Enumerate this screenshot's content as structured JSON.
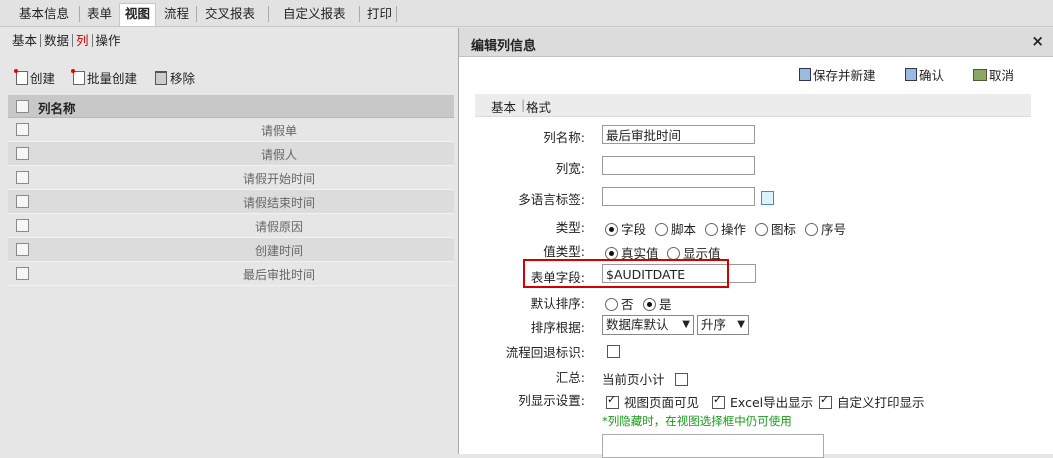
{
  "top_tabs": [
    "基本信息",
    "表单",
    "视图",
    "流程",
    "交叉报表",
    "自定义报表",
    "打印"
  ],
  "left": {
    "subtabs": [
      "基本",
      "数据",
      "列",
      "操作"
    ],
    "toolbar": {
      "create": "创建",
      "batch_create": "批量创建",
      "remove": "移除"
    },
    "grid_header": "列名称",
    "rows": [
      "请假单",
      "请假人",
      "请假开始时间",
      "请假结束时间",
      "请假原因",
      "创建时间",
      "最后审批时间"
    ]
  },
  "dialog": {
    "title": "编辑列信息",
    "close": "×",
    "buttons": {
      "save_new": "保存并新建",
      "ok": "确认",
      "cancel": "取消"
    },
    "form_tabs": [
      "基本",
      "格式"
    ],
    "fields": {
      "col_name": {
        "label": "列名称:",
        "value": "最后审批时间"
      },
      "col_width": {
        "label": "列宽:",
        "value": ""
      },
      "i18n": {
        "label": "多语言标签:",
        "value": ""
      },
      "type": {
        "label": "类型:",
        "options": [
          "字段",
          "脚本",
          "操作",
          "图标",
          "序号"
        ],
        "selected": "字段"
      },
      "value_type": {
        "label": "值类型:",
        "options": [
          "真实值",
          "显示值"
        ],
        "selected": "真实值"
      },
      "form_field": {
        "label": "表单字段:",
        "value": "$AUDITDATE"
      },
      "default_sort": {
        "label": "默认排序:",
        "options": [
          "否",
          "是"
        ],
        "selected": "是"
      },
      "sort_by": {
        "label": "排序根据:",
        "select1": "数据库默认",
        "select2": "升序"
      },
      "flow_back": {
        "label": "流程回退标识:"
      },
      "summary": {
        "label": "汇总:",
        "option": "当前页小计"
      },
      "display": {
        "label": "列显示设置:",
        "options": [
          "视图页面可见",
          "Excel导出显示",
          "自定义打印显示"
        ],
        "note": "*列隐藏时，在视图选择框中仍可使用"
      }
    }
  }
}
